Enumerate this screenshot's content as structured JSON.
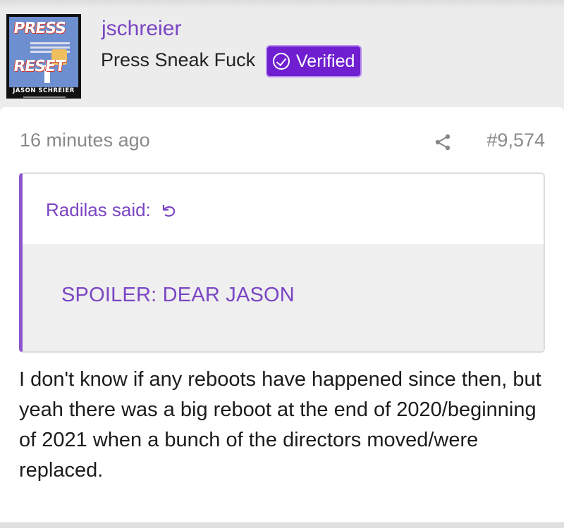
{
  "user": {
    "name": "jschreier",
    "title": "Press Sneak Fuck",
    "badge": "Verified",
    "avatar": {
      "word_top": "PRESS",
      "word_bottom": "RESET",
      "author": "JASON SCHREIER"
    }
  },
  "post": {
    "time": "16 minutes ago",
    "number": "#9,574",
    "quote": {
      "author": "Radilas said:",
      "spoiler_label": "SPOILER: DEAR JASON"
    },
    "text": "I don't know if any reboots have happened since then, but yeah there was a big reboot at the end of 2020/beginning of 2021 when a bunch of the directors moved/were replaced."
  },
  "colors": {
    "accent": "#7b45c4",
    "badge_bg": "#6f1fd0",
    "quote_bar": "#8b56d0",
    "muted": "#8a8a8a"
  },
  "icons": [
    "check-circle-icon",
    "share-icon",
    "reply-arrow-icon"
  ]
}
